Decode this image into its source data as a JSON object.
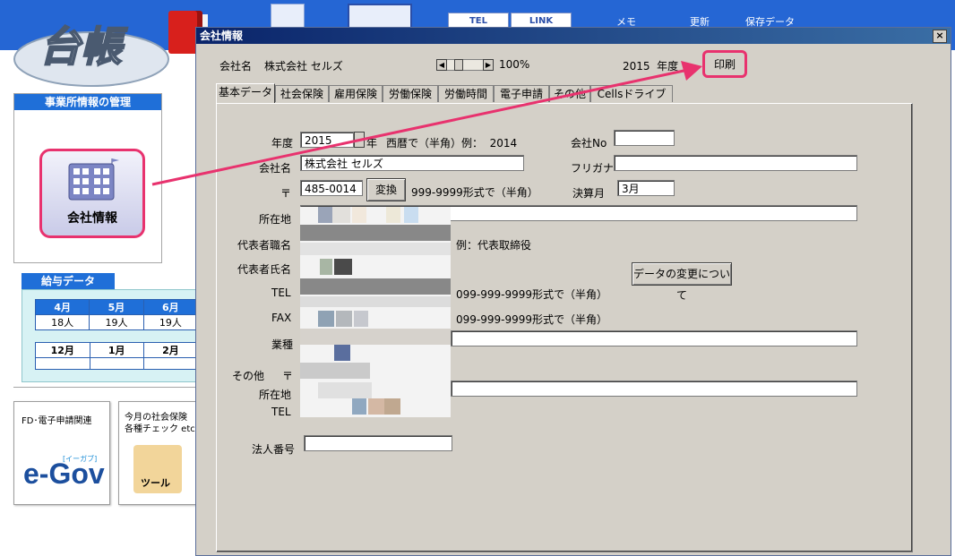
{
  "app": {
    "logo_text": "台帳",
    "top_texts": [
      "メモ",
      "更新",
      "保存データ"
    ],
    "top_tabs": [
      "TEL",
      "LINK"
    ]
  },
  "office_panel": {
    "title": "事業所情報の管理",
    "company_button": "会社情報"
  },
  "salary_panel": {
    "title": "給与データ",
    "row1_months": [
      "4月",
      "5月",
      "6月"
    ],
    "row1_values": [
      "18人",
      "19人",
      "19人"
    ],
    "row2_months": [
      "12月",
      "1月",
      "2月"
    ]
  },
  "cards": {
    "egov_title": "FD･電子申請関連",
    "egov_logo": "e-Gov",
    "egov_ruby": "[イーガブ]",
    "tools_line1": "今月の社会保険",
    "tools_line2": "各種チェック etc",
    "tools_label": "ツール"
  },
  "dialog": {
    "title": "会社情報",
    "close": "×",
    "header_company_label": "会社名",
    "header_company_value": "株式会社 セルズ",
    "zoom": "100%",
    "year_display": "2015  年度",
    "print_button": "印刷",
    "tabs": [
      "基本データ",
      "社会保険",
      "雇用保険",
      "労働保険",
      "労働時間",
      "電子申請",
      "その他",
      "Cellsドライブ"
    ],
    "form": {
      "year_label": "年度",
      "year_value": "2015",
      "year_unit": "年",
      "year_hint": "西暦で（半角）例：  2014",
      "company_no_label": "会社No",
      "company_no_value": "",
      "company_name_label": "会社名",
      "company_name_value": "株式会社 セルズ",
      "furigana_label": "フリガナ",
      "furigana_value": "",
      "zip_label": "〒",
      "zip_value": "485-0014",
      "convert_button": "変換",
      "zip_hint": "999-9999形式で（半角）",
      "fiscal_label": "決算月",
      "fiscal_value": "3月",
      "address_label": "所在地",
      "rep_title_label": "代表者職名",
      "rep_title_hint": "例：代表取締役",
      "rep_name_label": "代表者氏名",
      "data_change_button": "データの変更について",
      "tel_label": "TEL",
      "tel_hint": "099-999-9999形式で（半角）",
      "fax_label": "FAX",
      "fax_hint": "099-999-9999形式で（半角）",
      "industry_label": "業種",
      "other_label": "その他",
      "other_zip_label": "〒",
      "other_address_label": "所在地",
      "other_tel_label": "TEL",
      "corp_number_label": "法人番号",
      "corp_number_value": ""
    }
  },
  "colors": {
    "accent_blue": "#1f6fd8",
    "highlight_pink": "#e8326e",
    "dialog_gray": "#d4d0c8"
  }
}
